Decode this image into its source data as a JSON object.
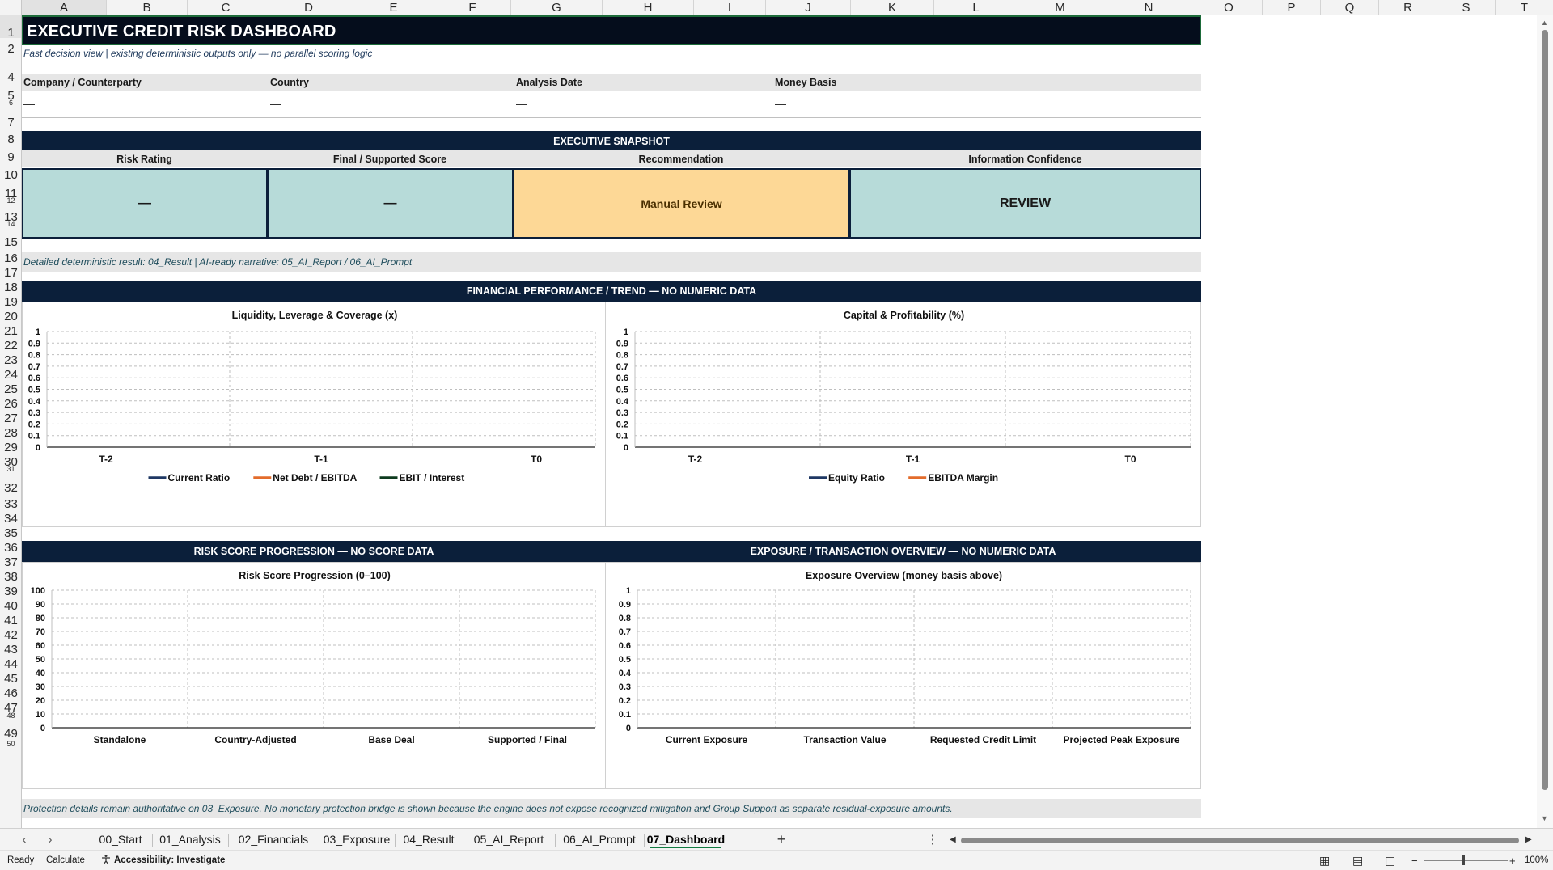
{
  "columns": [
    "A",
    "B",
    "C",
    "D",
    "E",
    "F",
    "G",
    "H",
    "I",
    "J",
    "K",
    "L",
    "M",
    "N",
    "O",
    "P",
    "Q",
    "R",
    "S",
    "T"
  ],
  "rows": [
    "1",
    "2",
    "4",
    "5",
    "6",
    "7",
    "8",
    "9",
    "10",
    "11",
    "12",
    "13",
    "14",
    "15",
    "16",
    "17",
    "18",
    "19",
    "20",
    "21",
    "22",
    "23",
    "24",
    "25",
    "26",
    "27",
    "28",
    "29",
    "30",
    "31",
    "32",
    "33",
    "34",
    "35",
    "36",
    "37",
    "38",
    "39",
    "40",
    "41",
    "42",
    "43",
    "44",
    "45",
    "46",
    "47",
    "48",
    "49",
    "50"
  ],
  "header": {
    "title": "EXECUTIVE CREDIT RISK DASHBOARD",
    "subtitle": "Fast decision view | existing deterministic outputs only — no parallel scoring logic"
  },
  "info": {
    "labels": [
      "Company / Counterparty",
      "Country",
      "Analysis Date",
      "Money Basis"
    ],
    "values": [
      "—",
      "—",
      "—",
      "—"
    ]
  },
  "snapshot": {
    "title": "EXECUTIVE SNAPSHOT",
    "kpis": [
      {
        "label": "Risk Rating",
        "value": "—"
      },
      {
        "label": "Final / Supported Score",
        "value": "—"
      },
      {
        "label": "Recommendation",
        "value": "Manual Review"
      },
      {
        "label": "Information Confidence",
        "value": "REVIEW"
      }
    ],
    "note": "Detailed deterministic result: 04_Result  |  AI-ready narrative: 05_AI_Report / 06_AI_Prompt"
  },
  "sections": {
    "financial": "FINANCIAL PERFORMANCE / TREND — NO NUMERIC DATA",
    "risk": "RISK SCORE PROGRESSION — NO SCORE DATA",
    "exposure": "EXPOSURE / TRANSACTION OVERVIEW — NO NUMERIC DATA"
  },
  "chart_data": [
    {
      "type": "line",
      "title": "Liquidity, Leverage & Coverage (x)",
      "categories": [
        "T-2",
        "T-1",
        "T0"
      ],
      "ylim": [
        0,
        1
      ],
      "yticks": [
        "0",
        "0.1",
        "0.2",
        "0.3",
        "0.4",
        "0.5",
        "0.6",
        "0.7",
        "0.8",
        "0.9",
        "1"
      ],
      "series": [
        {
          "name": "Current Ratio",
          "color": "#1f3864",
          "values": []
        },
        {
          "name": "Net Debt / EBITDA",
          "color": "#e36c2b",
          "values": []
        },
        {
          "name": "EBIT / Interest",
          "color": "#0e3b1f",
          "values": []
        }
      ],
      "grid": true,
      "legend": "bottom"
    },
    {
      "type": "line",
      "title": "Capital & Profitability (%)",
      "categories": [
        "T-2",
        "T-1",
        "T0"
      ],
      "ylim": [
        0,
        1
      ],
      "yticks": [
        "0",
        "0.1",
        "0.2",
        "0.3",
        "0.4",
        "0.5",
        "0.6",
        "0.7",
        "0.8",
        "0.9",
        "1"
      ],
      "series": [
        {
          "name": "Equity Ratio",
          "color": "#1f3864",
          "values": []
        },
        {
          "name": "EBITDA Margin",
          "color": "#e36c2b",
          "values": []
        }
      ],
      "grid": true,
      "legend": "bottom"
    },
    {
      "type": "bar",
      "title": "Risk Score Progression (0–100)",
      "categories": [
        "Standalone",
        "Country-Adjusted",
        "Base Deal",
        "Supported / Final"
      ],
      "ylim": [
        0,
        100
      ],
      "yticks": [
        "0",
        "10",
        "20",
        "30",
        "40",
        "50",
        "60",
        "70",
        "80",
        "90",
        "100"
      ],
      "series": [],
      "grid": true
    },
    {
      "type": "bar",
      "title": "Exposure Overview (money basis above)",
      "categories": [
        "Current Exposure",
        "Transaction Value",
        "Requested Credit Limit",
        "Projected Peak Exposure"
      ],
      "ylim": [
        0,
        1
      ],
      "yticks": [
        "0",
        "0.1",
        "0.2",
        "0.3",
        "0.4",
        "0.5",
        "0.6",
        "0.7",
        "0.8",
        "0.9",
        "1"
      ],
      "series": [],
      "grid": true
    }
  ],
  "footer_note": "Protection details remain authoritative on 03_Exposure. No monetary protection bridge is shown because the engine does not expose recognized mitigation and Group Support as separate residual-exposure amounts.",
  "tabs": [
    "00_Start",
    "01_Analysis",
    "02_Financials",
    "03_Exposure",
    "04_Result",
    "05_AI_Report",
    "06_AI_Prompt",
    "07_Dashboard"
  ],
  "active_tab": "07_Dashboard",
  "status": {
    "ready": "Ready",
    "calculate": "Calculate",
    "accessibility": "Accessibility: Investigate",
    "zoom": "100%"
  },
  "colors": {
    "navy": "#0b1f3a",
    "teal": "#b7dbd9",
    "amber": "#fdd896",
    "excel_green": "#107c41"
  }
}
